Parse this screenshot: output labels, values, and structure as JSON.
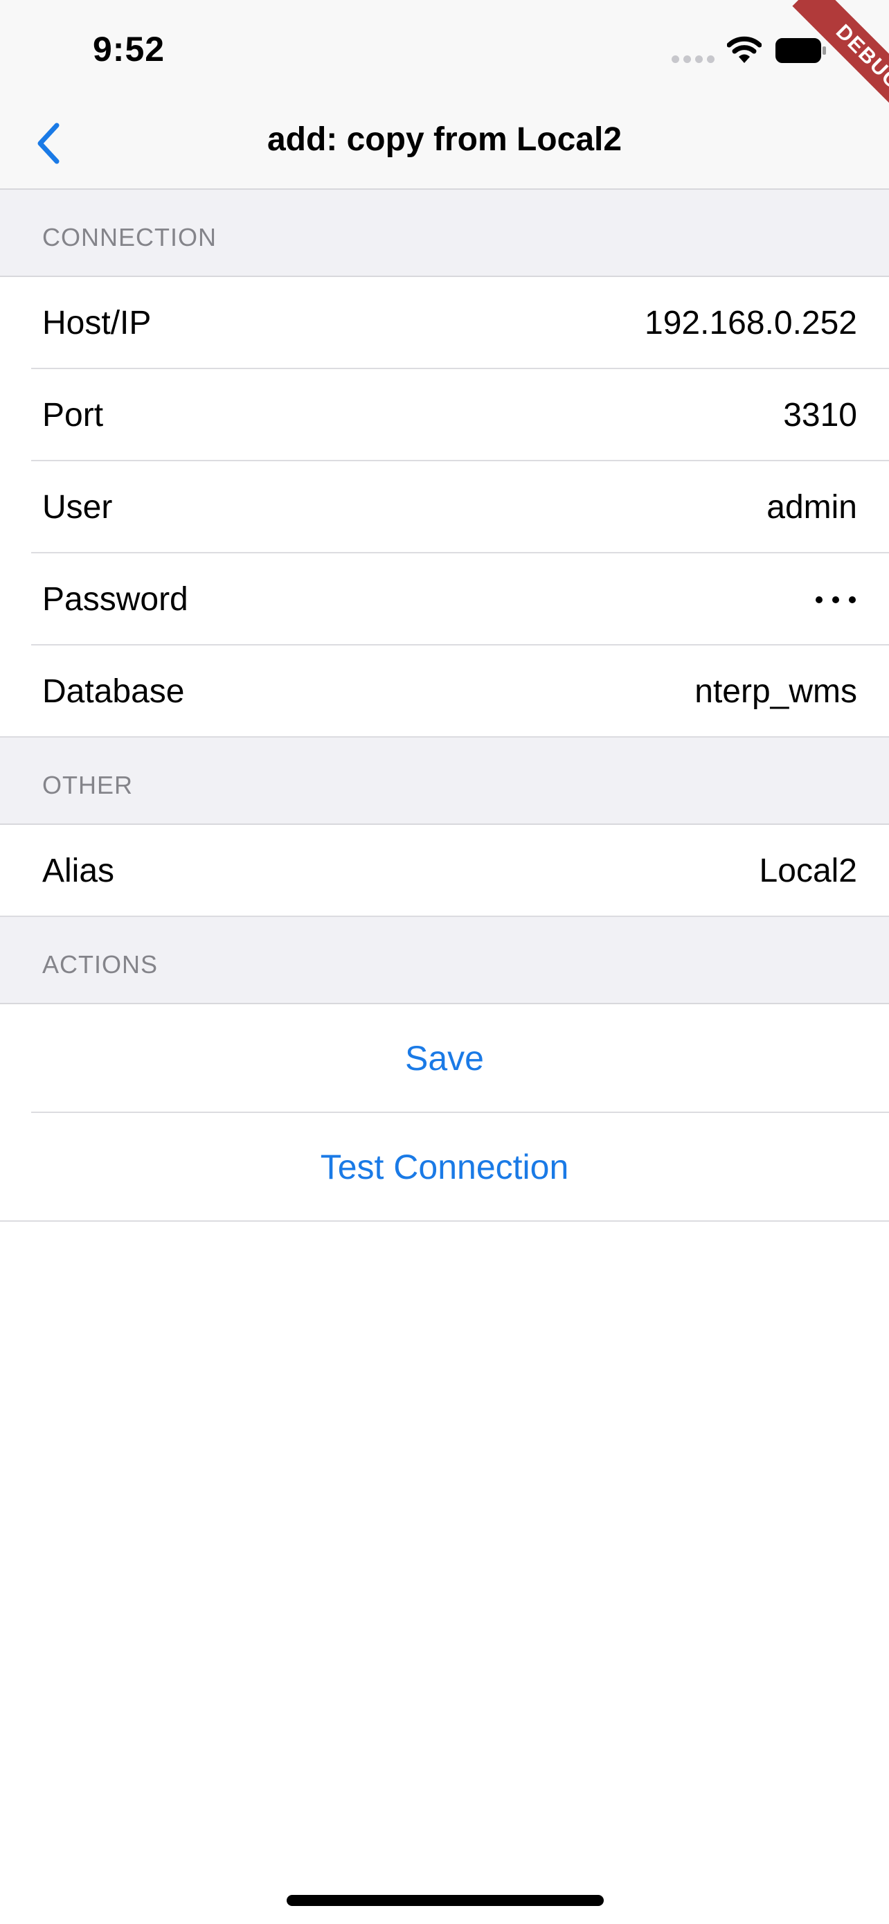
{
  "status_bar": {
    "time": "9:52",
    "signal_icon": "cellular-signal-icon",
    "wifi_icon": "wifi-icon",
    "battery_icon": "battery-icon"
  },
  "debug_banner": "DEBUG",
  "nav": {
    "back_icon": "chevron-left-icon",
    "title": "add: copy from Local2"
  },
  "sections": {
    "connection": {
      "header": "CONNECTION",
      "rows": [
        {
          "label": "Host/IP",
          "value": "192.168.0.252"
        },
        {
          "label": "Port",
          "value": "3310"
        },
        {
          "label": "User",
          "value": "admin"
        },
        {
          "label": "Password",
          "value_masked": true
        },
        {
          "label": "Database",
          "value": "nterp_wms"
        }
      ]
    },
    "other": {
      "header": "OTHER",
      "rows": [
        {
          "label": "Alias",
          "value": "Local2"
        }
      ]
    },
    "actions": {
      "header": "ACTIONS",
      "items": [
        {
          "label": "Save"
        },
        {
          "label": "Test Connection"
        }
      ]
    }
  },
  "colors": {
    "accent": "#1a7ae6",
    "section_background": "#f1f1f5",
    "debug_ribbon": "#b13a3a"
  }
}
